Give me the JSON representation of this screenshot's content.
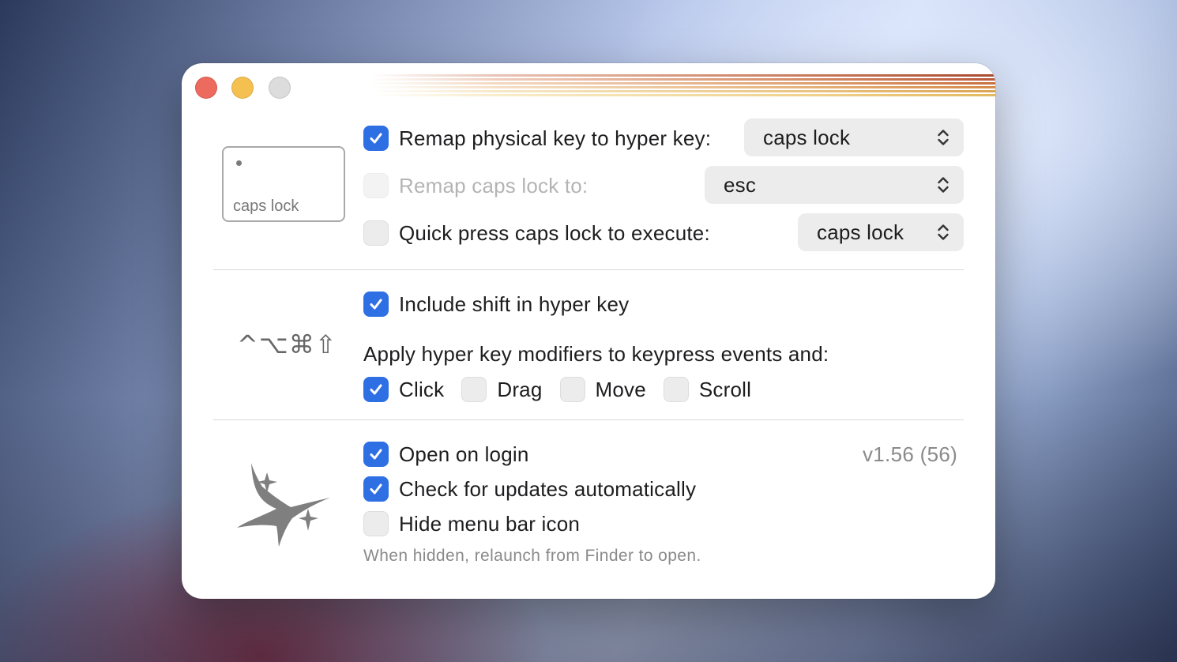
{
  "window": {
    "controls": {
      "close": "close-button",
      "minimize": "minimize-button",
      "zoom": "zoom-button"
    }
  },
  "colors": {
    "accent": "#2f6fe4",
    "close": "#ec6a5e",
    "minimize": "#f4c04f",
    "zoom": "#dcdcdc"
  },
  "key_section": {
    "keycap_label": "caps lock",
    "remap": {
      "label": "Remap physical key to hyper key:",
      "checked": true,
      "value": "caps lock"
    },
    "remap_caps": {
      "label": "Remap caps lock to:",
      "checked": false,
      "enabled": false,
      "value": "esc"
    },
    "quick_press": {
      "label": "Quick press caps lock to execute:",
      "checked": false,
      "value": "caps lock"
    }
  },
  "modifier_section": {
    "symbols": "^⌥⌘⇧",
    "include_shift": {
      "label": "Include shift in hyper key",
      "checked": true
    },
    "apply_heading": "Apply hyper key modifiers to keypress events and:",
    "events": [
      {
        "label": "Click",
        "checked": true
      },
      {
        "label": "Drag",
        "checked": false
      },
      {
        "label": "Move",
        "checked": false
      },
      {
        "label": "Scroll",
        "checked": false
      }
    ]
  },
  "general_section": {
    "icon": "sparkles-icon",
    "version": "v1.56 (56)",
    "open_on_login": {
      "label": "Open on login",
      "checked": true
    },
    "check_updates": {
      "label": "Check for updates automatically",
      "checked": true
    },
    "hide_menu_bar": {
      "label": "Hide menu bar icon",
      "checked": false
    },
    "note": "When hidden, relaunch from Finder to open."
  }
}
